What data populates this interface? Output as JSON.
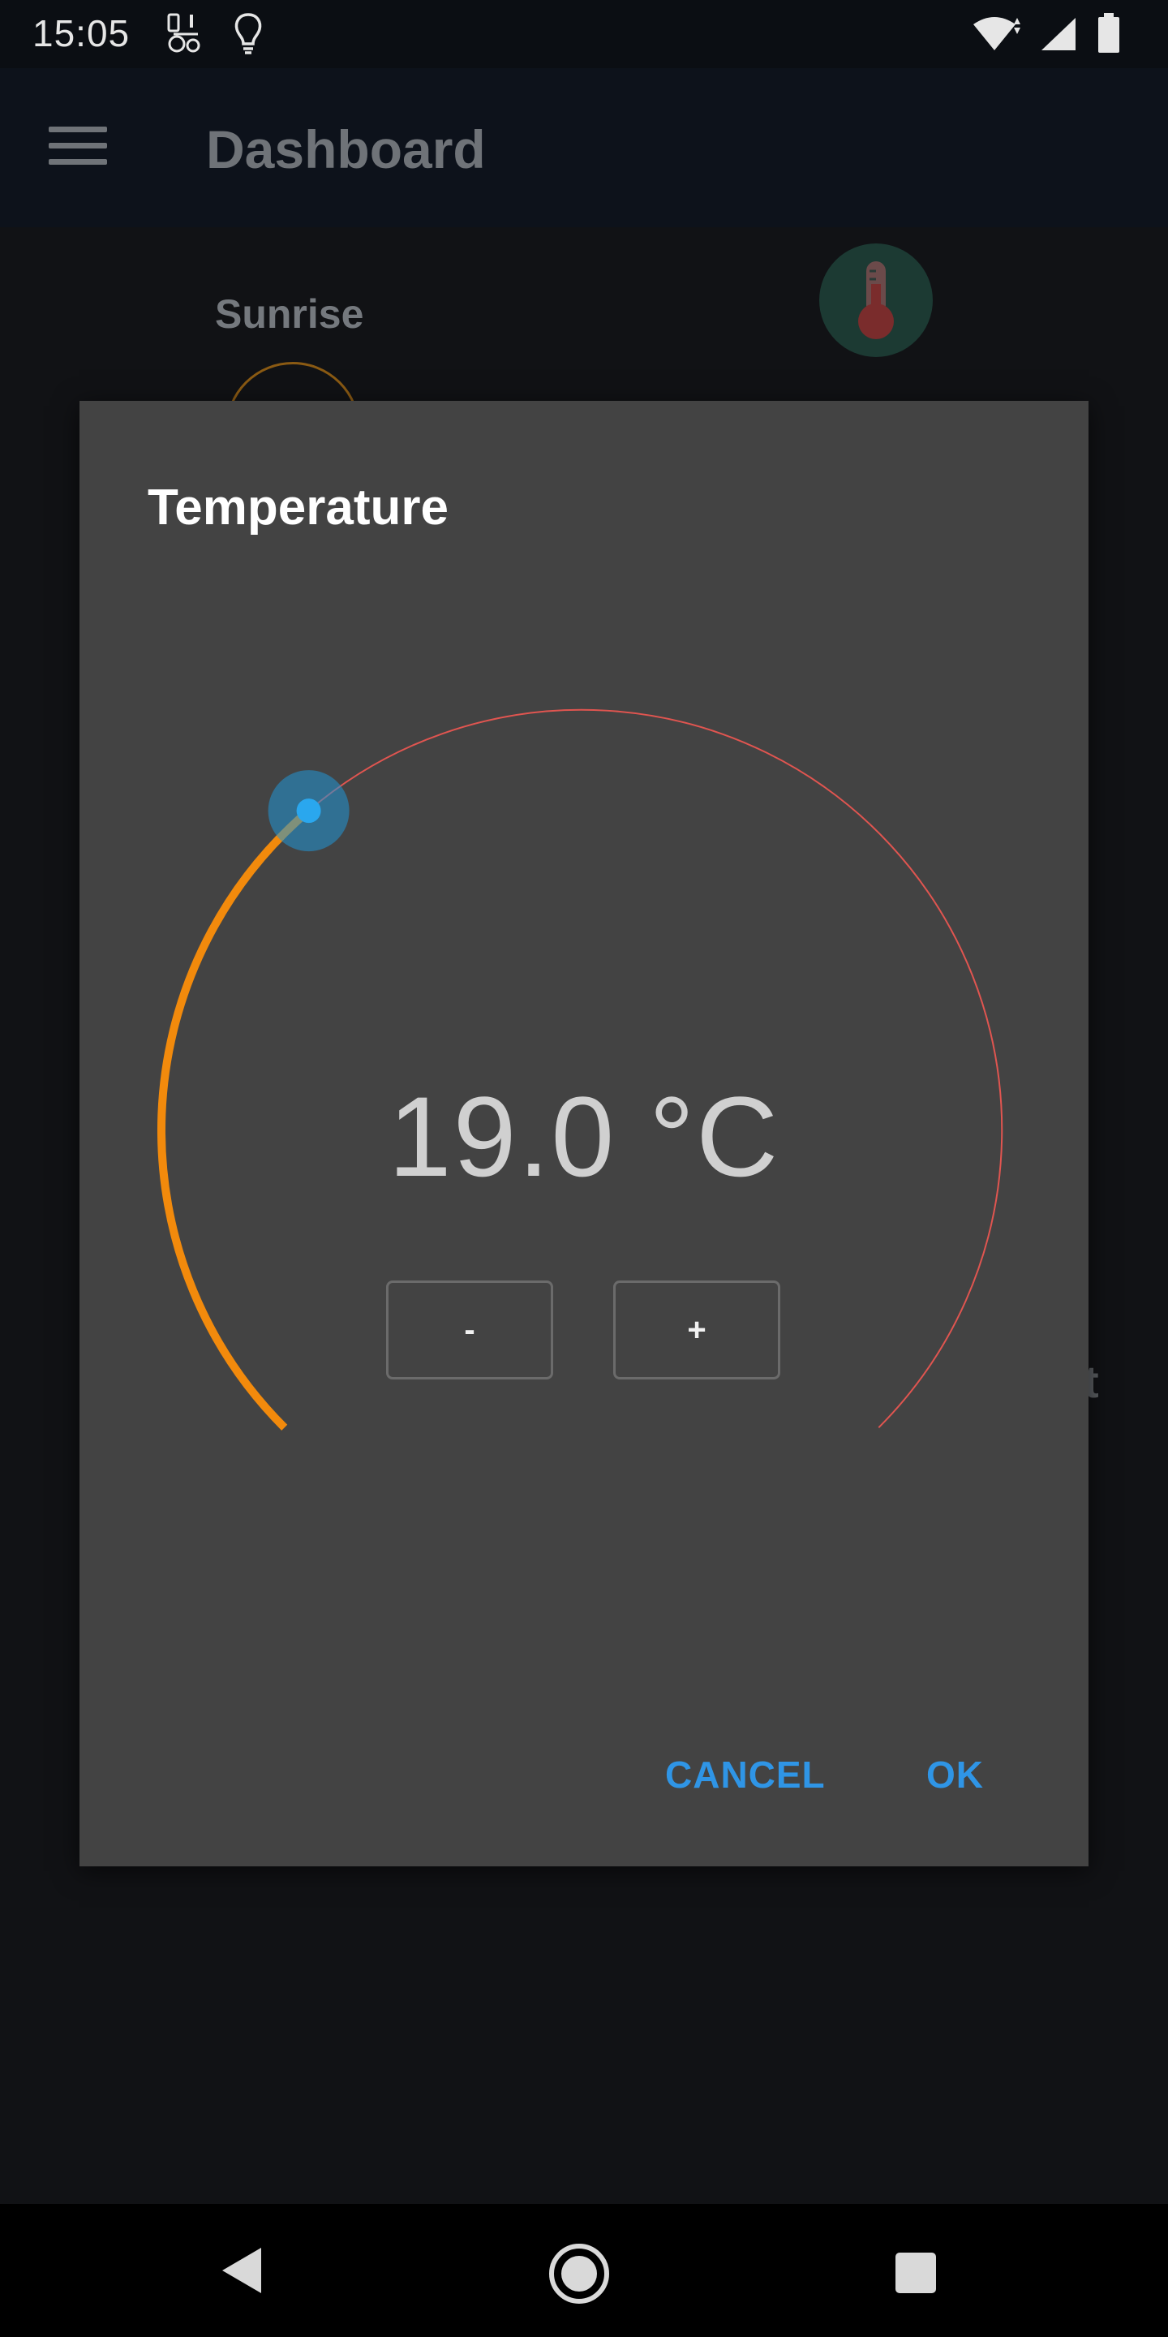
{
  "status_bar": {
    "time": "15:05",
    "icons": [
      "notification-app-icon",
      "lightbulb-icon",
      "wifi-icon",
      "signal-icon",
      "battery-icon"
    ]
  },
  "app_bar": {
    "title": "Dashboard",
    "menu_icon": "hamburger-menu-icon"
  },
  "dashboard": {
    "widget_label": "Sunrise",
    "edge_text": "t",
    "thermometer_icon": "thermometer-icon"
  },
  "dialog": {
    "title": "Temperature",
    "value_text": "19.0 °C",
    "decrement_label": "-",
    "increment_label": "+",
    "cancel_label": "CANCEL",
    "ok_label": "OK",
    "dial": {
      "progress_fraction": 0.35,
      "progress_color": "#f28a0c",
      "track_color": "#e05550",
      "thumb_color": "#2196d6"
    }
  },
  "nav_bar": {
    "icons": [
      "back-icon",
      "home-icon",
      "recents-icon"
    ]
  }
}
